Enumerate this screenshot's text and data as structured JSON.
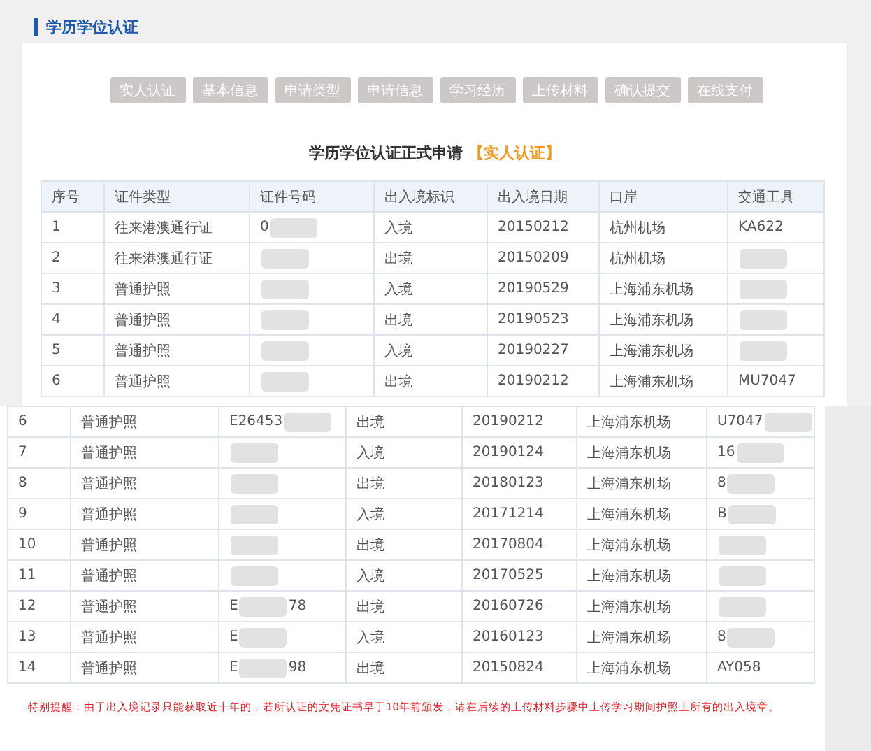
{
  "page_title": "学历学位认证",
  "steps": [
    "实人认证",
    "基本信息",
    "申请类型",
    "申请信息",
    "学习经历",
    "上传材料",
    "确认提交",
    "在线支付"
  ],
  "form_title": {
    "text": "学历学位认证正式申请",
    "highlight": "【实人认证】"
  },
  "table": {
    "columns": [
      "序号",
      "证件类型",
      "证件号码",
      "出入境标识",
      "出入境日期",
      "口岸",
      "交通工具"
    ],
    "rows": [
      {
        "no": "1",
        "type": "往来港澳通行证",
        "id_number": "0",
        "id_redacted": true,
        "direction": "入境",
        "date": "20150212",
        "port": "杭州机场",
        "transport": "KA622"
      },
      {
        "no": "2",
        "type": "往来港澳通行证",
        "id_redacted": true,
        "direction": "出境",
        "date": "20150209",
        "port": "杭州机场",
        "transport_redacted": true
      },
      {
        "no": "3",
        "type": "普通护照",
        "id_redacted": true,
        "direction": "入境",
        "date": "20190529",
        "port": "上海浦东机场",
        "transport_redacted": true
      },
      {
        "no": "4",
        "type": "普通护照",
        "id_redacted": true,
        "direction": "出境",
        "date": "20190523",
        "port": "上海浦东机场",
        "transport_redacted": true
      },
      {
        "no": "5",
        "type": "普通护照",
        "id_redacted": true,
        "direction": "入境",
        "date": "20190227",
        "port": "上海浦东机场",
        "transport_redacted": true
      },
      {
        "no": "6",
        "type": "普通护照",
        "id_redacted": true,
        "direction": "出境",
        "date": "20190212",
        "port": "上海浦东机场",
        "transport": "MU7047"
      }
    ]
  },
  "continued_table": {
    "rows": [
      {
        "no": "6",
        "type": "普通护照",
        "id_number": "E26453",
        "id_redacted": true,
        "direction": "出境",
        "date": "20190212",
        "port": "上海浦东机场",
        "transport": "U7047",
        "transport_redacted": true
      },
      {
        "no": "7",
        "type": "普通护照",
        "id_redacted": true,
        "direction": "入境",
        "date": "20190124",
        "port": "上海浦东机场",
        "transport": "16",
        "transport_redacted": true
      },
      {
        "no": "8",
        "type": "普通护照",
        "id_redacted": true,
        "direction": "出境",
        "date": "20180123",
        "port": "上海浦东机场",
        "transport": "8",
        "transport_redacted": true
      },
      {
        "no": "9",
        "type": "普通护照",
        "id_redacted": true,
        "direction": "入境",
        "date": "20171214",
        "port": "上海浦东机场",
        "transport": "B",
        "transport_redacted": true
      },
      {
        "no": "10",
        "type": "普通护照",
        "id_redacted": true,
        "direction": "出境",
        "date": "20170804",
        "port": "上海浦东机场",
        "transport_redacted": true
      },
      {
        "no": "11",
        "type": "普通护照",
        "id_redacted": true,
        "direction": "入境",
        "date": "20170525",
        "port": "上海浦东机场",
        "transport_redacted": true
      },
      {
        "no": "12",
        "type": "普通护照",
        "id_number": "E",
        "id_redacted": true,
        "id_suffix": "78",
        "direction": "出境",
        "date": "20160726",
        "port": "上海浦东机场",
        "transport_redacted": true
      },
      {
        "no": "13",
        "type": "普通护照",
        "id_number": "E",
        "id_redacted": true,
        "direction": "入境",
        "date": "20160123",
        "port": "上海浦东机场",
        "transport": "8",
        "transport_redacted": true
      },
      {
        "no": "14",
        "type": "普通护照",
        "id_number": "E",
        "id_redacted": true,
        "id_suffix": "98",
        "direction": "出境",
        "date": "20150824",
        "port": "上海浦东机场",
        "transport": "AY058"
      }
    ]
  },
  "notice": "特别提醒：由于出入境记录只能获取近十年的，若所认证的文凭证书早于10年前颁发，请在后续的上传材料步骤中上传学习期间护照上所有的出入境章。"
}
